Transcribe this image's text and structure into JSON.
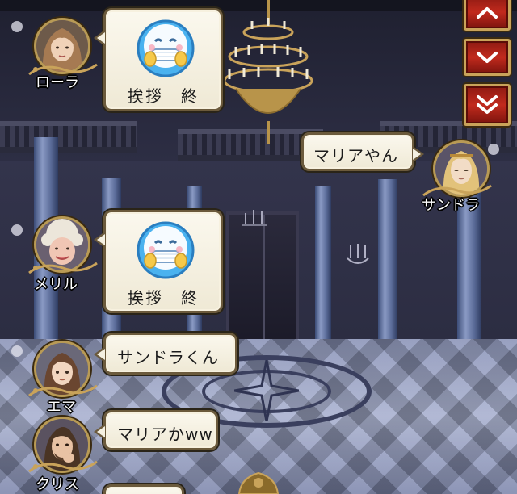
{
  "chat": {
    "messages": [
      {
        "speaker": "ローラ",
        "type": "stamp",
        "stamp_icon": "smiling-masked-face-stamp",
        "caption": "挨拶　終"
      },
      {
        "speaker": "サンドラ",
        "type": "text",
        "text": "マリアやん"
      },
      {
        "speaker": "メリル",
        "type": "stamp",
        "stamp_icon": "smiling-masked-face-stamp",
        "caption": "挨拶　終"
      },
      {
        "speaker": "エマ",
        "type": "text",
        "text": "サンドラくん"
      },
      {
        "speaker": "クリス",
        "type": "text",
        "text": "マリアかww"
      }
    ]
  },
  "scroll_controls": {
    "buttons": [
      {
        "icon": "chevron-up-icon"
      },
      {
        "icon": "chevron-down-icon"
      },
      {
        "icon": "double-chevron-down-icon"
      }
    ]
  },
  "colors": {
    "bubble_bg": "#f5f1e2",
    "bubble_border": "#6b5a3c",
    "button_red": "#c12a1d",
    "button_gold": "#c9a35a",
    "stamp_blue": "#3aa4e6"
  }
}
